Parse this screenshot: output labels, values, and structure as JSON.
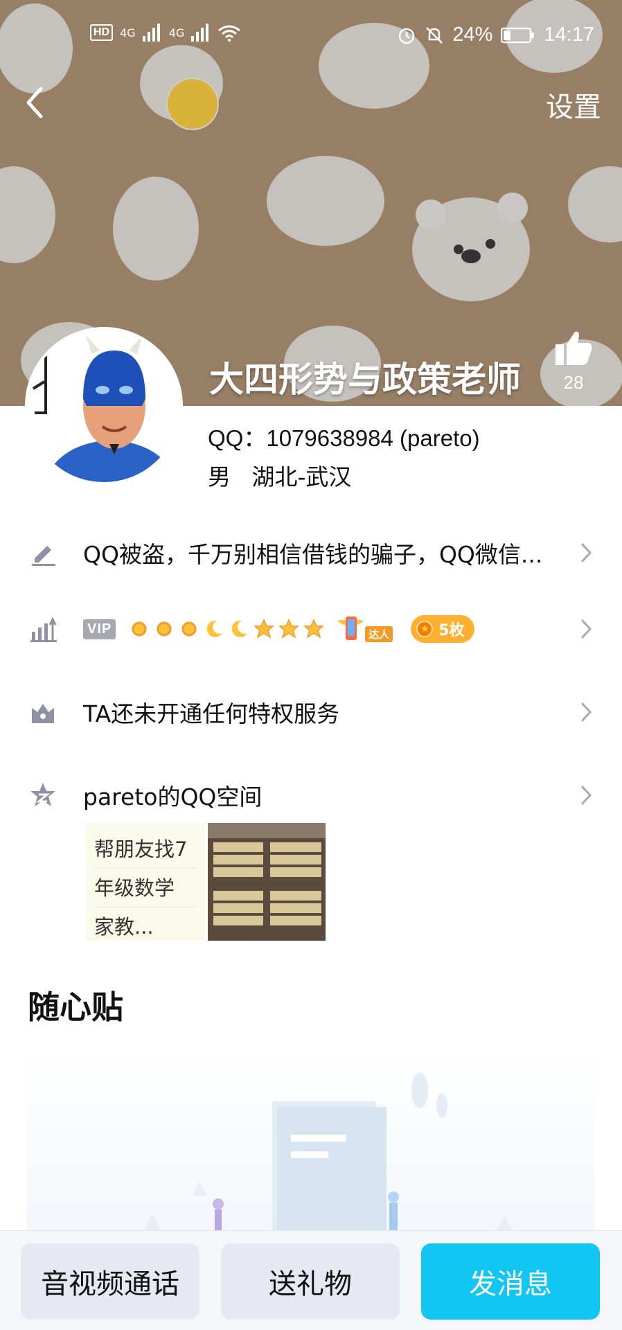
{
  "status_bar": {
    "hd_label": "HD",
    "network_1": "4G",
    "network_2": "4G",
    "battery": "24%",
    "time": "14:17"
  },
  "header": {
    "settings_label": "设置",
    "nickname": "大四形势与政策老师",
    "like_count": "28"
  },
  "profile": {
    "qq_line": "QQ：1079638984 (pareto)",
    "gender": "男",
    "location": "湖北-武汉"
  },
  "rows": {
    "signature": "QQ被盗，千万别相信借钱的骗子，QQ微信...",
    "vip_tag": "VIP",
    "talent_label": "达人",
    "medal_label": "5枚",
    "privilege": "TA还未开通任何特权服务",
    "qzone": "pareto的QQ空间"
  },
  "qzone_preview": {
    "lines": [
      "帮朋友找7",
      "年级数学",
      "家教..."
    ]
  },
  "section": {
    "title": "随心贴"
  },
  "bottom_bar": {
    "call_label": "音视频通话",
    "gift_label": "送礼物",
    "message_label": "发消息"
  },
  "colors": {
    "banner": "#977f66",
    "accent_blue": "#12c6f3",
    "medal_orange": "#ffb02e",
    "icon_gray": "#8e90a4"
  }
}
